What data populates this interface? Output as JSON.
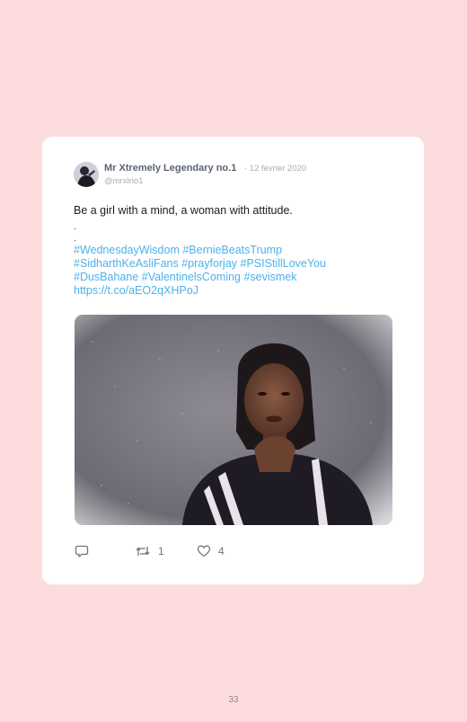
{
  "tweet": {
    "author_name": "Mr Xtremely Legendary no.1",
    "date": "· 12 février 2020",
    "handle": "@mrxlno1",
    "text": "Be a girl with a mind, a woman with attitude.",
    "dots": [
      ".",
      "."
    ],
    "hashtag_lines": [
      "#WednesdayWisdom #BernieBeatsTrump",
      "#SidharthKeAsliFans #prayforjay #PSIStillLoveYou",
      "#DusBahane #ValentinelsComing #sevismek",
      "https://t.co/aEO2qXHPoJ"
    ],
    "actions": {
      "reply_icon": "reply-icon",
      "retweet_icon": "retweet-icon",
      "retweet_count": "1",
      "like_icon": "heart-icon",
      "like_count": "4"
    }
  },
  "page": {
    "number": "33"
  },
  "colors": {
    "background": "#fcdcdc",
    "card": "#ffffff",
    "link": "#4db1ea",
    "muted": "#a7aeb6",
    "icon": "#6b7782"
  }
}
